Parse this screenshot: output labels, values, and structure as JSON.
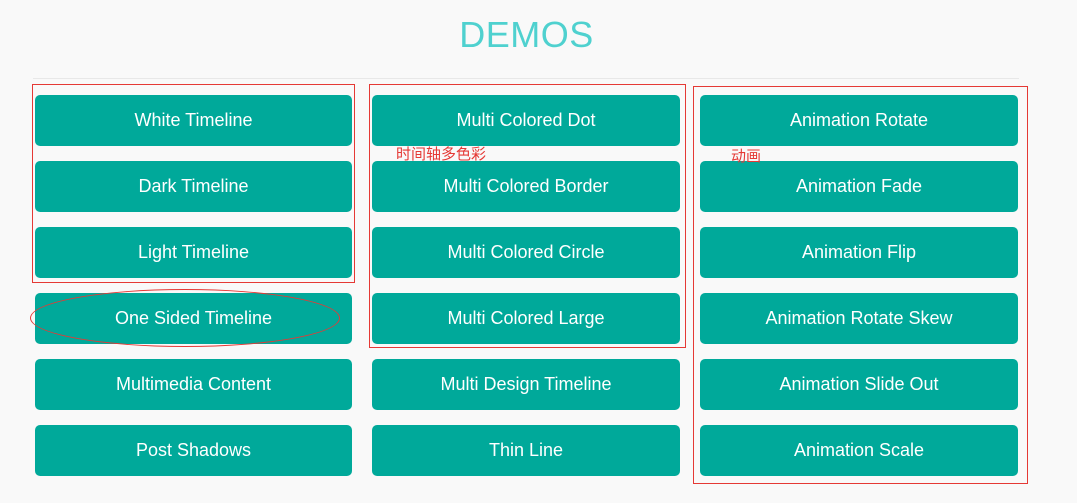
{
  "header": {
    "title": "DEMOS"
  },
  "columns": [
    {
      "buttons": [
        "White Timeline",
        "Dark Timeline",
        "Light Timeline",
        "One Sided Timeline",
        "Multimedia Content",
        "Post Shadows"
      ]
    },
    {
      "buttons": [
        "Multi Colored Dot",
        "Multi Colored Border",
        "Multi Colored Circle",
        "Multi Colored Large",
        "Multi Design Timeline",
        "Thin Line"
      ]
    },
    {
      "buttons": [
        "Animation Rotate",
        "Animation Fade",
        "Animation Flip",
        "Animation Rotate Skew",
        "Animation Slide Out",
        "Animation Scale"
      ]
    }
  ],
  "annotations": {
    "multicolor_note": "时间轴多色彩",
    "animation_note": "动画",
    "color": "#e53935"
  },
  "colors": {
    "accent": "#00a99a",
    "title": "#4fd1cf",
    "background": "#f9f9f9"
  }
}
